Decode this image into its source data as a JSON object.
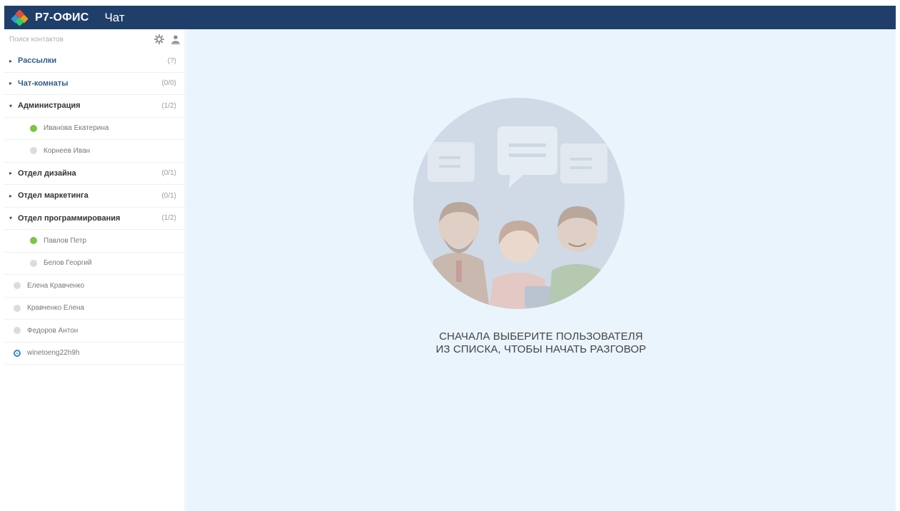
{
  "header": {
    "brand": "Р7-ОФИС",
    "module": "Чат"
  },
  "colors": {
    "topbar": "#1f3f6a",
    "main_bg": "#eaf4fd",
    "online": "#7ec440",
    "offline": "#dcdcdc",
    "me_ring": "#3f82c4"
  },
  "sidebar": {
    "search_placeholder": "Поиск контактов",
    "tools": [
      "gear-icon",
      "add-user-icon"
    ],
    "items": [
      {
        "kind": "group",
        "name": "Рассылки",
        "count": "(?)",
        "expanded": false,
        "accent": true
      },
      {
        "kind": "group",
        "name": "Чат-комнаты",
        "count": "(0/0)",
        "expanded": false,
        "accent": true
      },
      {
        "kind": "group",
        "name": "Администрация",
        "count": "(1/2)",
        "expanded": true,
        "accent": false
      },
      {
        "kind": "member",
        "name": "Иванова Екатерина",
        "status": "online"
      },
      {
        "kind": "member",
        "name": "Корнеев Иван",
        "status": "offline"
      },
      {
        "kind": "group",
        "name": "Отдел дизайна",
        "count": "(0/1)",
        "expanded": false,
        "accent": false
      },
      {
        "kind": "group",
        "name": "Отдел маркетинга",
        "count": "(0/1)",
        "expanded": false,
        "accent": false
      },
      {
        "kind": "group",
        "name": "Отдел программирования",
        "count": "(1/2)",
        "expanded": true,
        "accent": false
      },
      {
        "kind": "member",
        "name": "Павлов Петр",
        "status": "online"
      },
      {
        "kind": "member",
        "name": "Белов Георгий",
        "status": "offline"
      },
      {
        "kind": "contact",
        "name": "Елена Кравченко",
        "status": "offline"
      },
      {
        "kind": "contact",
        "name": "Кравченко Елена",
        "status": "offline"
      },
      {
        "kind": "contact",
        "name": "Федоров Антон",
        "status": "offline"
      },
      {
        "kind": "contact",
        "name": "winetoeng22h9h",
        "status": "me"
      }
    ]
  },
  "main": {
    "empty_line1": "СНАЧАЛА ВЫБЕРИТЕ ПОЛЬЗОВАТЕЛЯ",
    "empty_line2": "ИЗ СПИСКА, ЧТОБЫ НАЧАТЬ РАЗГОВОР"
  }
}
